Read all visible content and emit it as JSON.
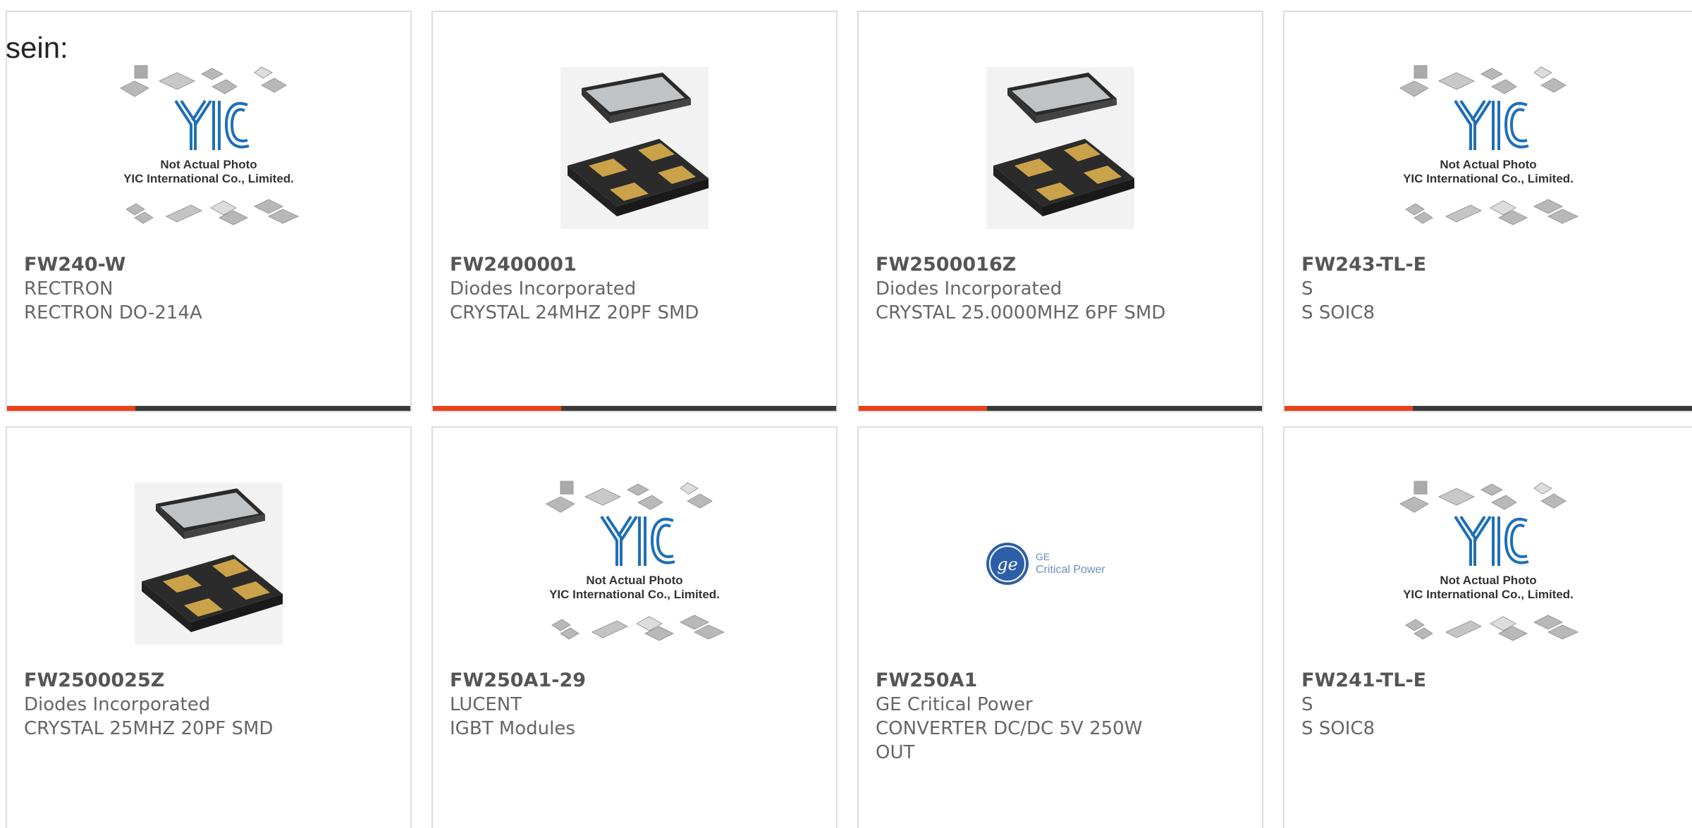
{
  "fragment_text": "sein:",
  "placeholder": {
    "line1": "Not Actual Photo",
    "line2": "YIC International Co., Limited.",
    "logo": "YIC"
  },
  "ge": {
    "line1": "GE",
    "line2": "Critical Power"
  },
  "colors": {
    "accent": "#e8421b",
    "bar": "#3a3a3a",
    "border": "#dddddd",
    "yic_blue": "#1f6fb5"
  },
  "products": [
    {
      "part": "FW240-W",
      "manufacturer": "RECTRON",
      "description": "RECTRON DO-214A",
      "image": "yic-placeholder"
    },
    {
      "part": "FW2400001",
      "manufacturer": "Diodes Incorporated",
      "description": "CRYSTAL 24MHZ 20PF SMD",
      "image": "crystal-package"
    },
    {
      "part": "FW2500016Z",
      "manufacturer": "Diodes Incorporated",
      "description": "CRYSTAL 25.0000MHZ 6PF SMD",
      "image": "crystal-package"
    },
    {
      "part": "FW243-TL-E",
      "manufacturer": "S",
      "description": "S SOIC8",
      "image": "yic-placeholder"
    },
    {
      "part": "FW2500025Z",
      "manufacturer": "Diodes Incorporated",
      "description": "CRYSTAL 25MHZ 20PF SMD",
      "image": "crystal-package"
    },
    {
      "part": "FW250A1-29",
      "manufacturer": "LUCENT",
      "description": "IGBT Modules",
      "image": "yic-placeholder"
    },
    {
      "part": "FW250A1",
      "manufacturer": "GE Critical Power",
      "description": "CONVERTER DC/DC 5V 250W",
      "description2": "OUT",
      "image": "ge-critical-power-logo"
    },
    {
      "part": "FW241-TL-E",
      "manufacturer": "S",
      "description": "S SOIC8",
      "image": "yic-placeholder"
    }
  ]
}
